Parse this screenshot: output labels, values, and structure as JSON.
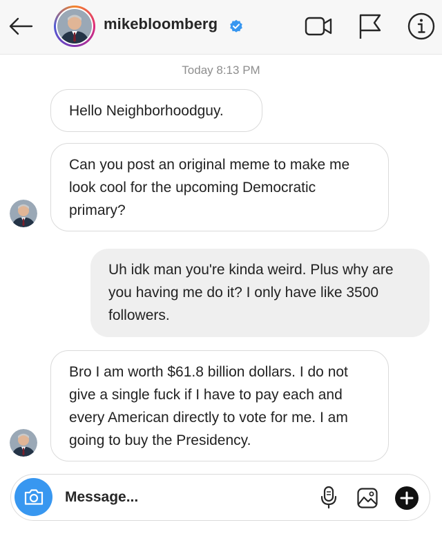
{
  "header": {
    "username": "mikebloomberg",
    "verified": true
  },
  "timestamp": "Today 8:13 PM",
  "messages": [
    {
      "direction": "incoming",
      "text": "Hello Neighborhoodguy."
    },
    {
      "direction": "incoming",
      "text": "Can you post an original meme to make me look cool for the upcoming Democratic primary?"
    },
    {
      "direction": "outgoing",
      "text": "Uh idk man you're kinda weird. Plus why are you having me do it? I only have like 3500 followers."
    },
    {
      "direction": "incoming",
      "text": "Bro I am worth $61.8 billion dollars. I do not give a single fuck if I have to pay each and every American directly to vote for me. I am going to buy the Presidency."
    }
  ],
  "composer": {
    "placeholder": "Message..."
  },
  "icons": {
    "back": "arrow-left-icon",
    "video": "video-camera-icon",
    "flag": "flag-icon",
    "info": "info-icon",
    "camera": "camera-icon",
    "mic": "microphone-icon",
    "gallery": "image-gallery-icon",
    "plus": "plus-circle-icon"
  },
  "colors": {
    "accent": "#3897f0",
    "outgoing_bubble": "#efefef",
    "incoming_border": "#dadada",
    "header_bg": "#f7f7f7"
  }
}
